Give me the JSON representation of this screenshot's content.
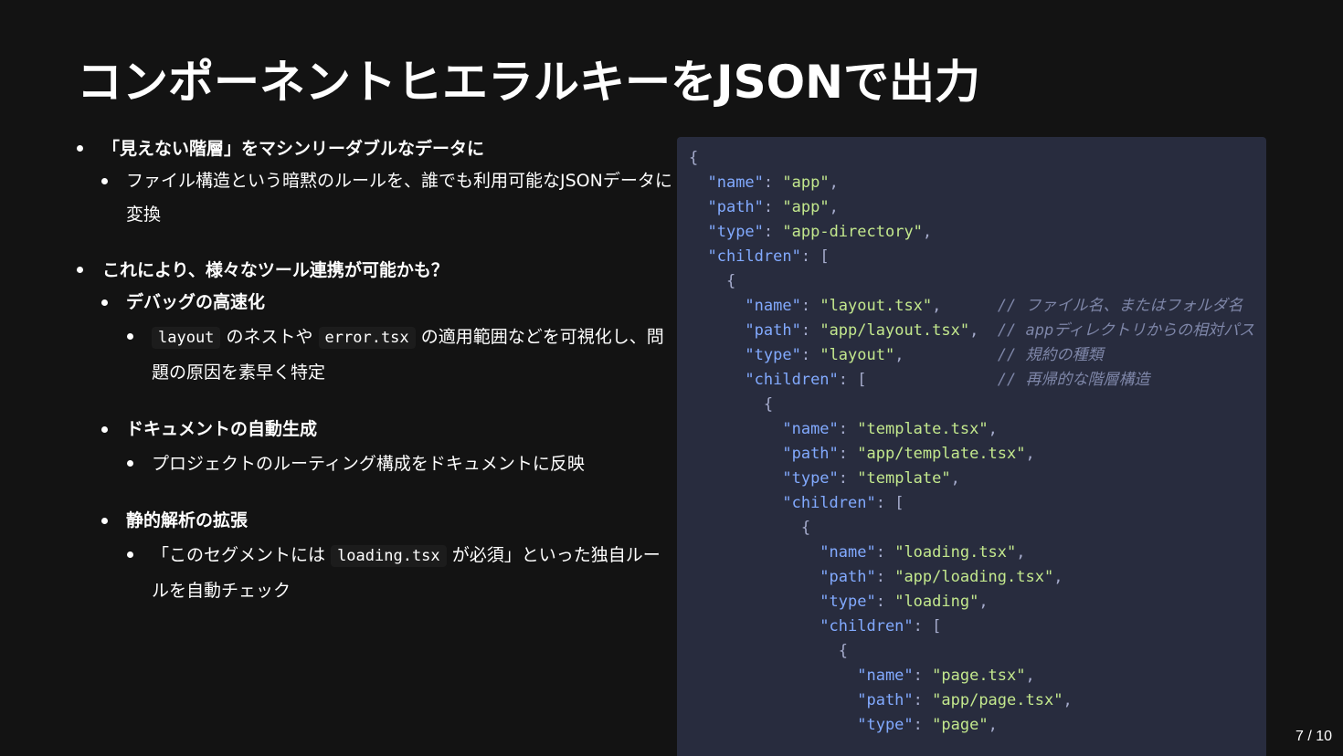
{
  "slide": {
    "title": "コンポーネントヒエラルキーをJSONで出力",
    "page_indicator": "7 / 10"
  },
  "bullets": {
    "b1": {
      "text": "「見えない階層」をマシンリーダブルなデータに",
      "sub1": "ファイル構造という暗黙のルールを、誰でも利用可能なJSONデータに変換"
    },
    "b2": {
      "text": "これにより、様々なツール連携が可能かも？",
      "debug": {
        "text": "デバッグの高速化",
        "detail_code1": "layout",
        "detail_mid": "のネストや",
        "detail_code2": "error.tsx",
        "detail_end": "の適用範囲などを可視化し、問題の原因を素早く特定"
      },
      "docs": {
        "text": "ドキュメントの自動生成",
        "detail": "プロジェクトのルーティング構成をドキュメントに反映"
      },
      "static": {
        "text": "静的解析の拡張",
        "detail_start": "「このセグメントには",
        "detail_code": "loading.tsx",
        "detail_end": "が必須」といった独自ルールを自動チェック"
      }
    }
  },
  "code": {
    "lang": "json",
    "lines": [
      {
        "indent": "",
        "parts": [
          {
            "t": "pun",
            "v": "{"
          }
        ]
      },
      {
        "indent": "  ",
        "parts": [
          {
            "t": "key",
            "v": "\"name\""
          },
          {
            "t": "pun",
            "v": ": "
          },
          {
            "t": "str",
            "v": "\"app\""
          },
          {
            "t": "pun",
            "v": ","
          }
        ]
      },
      {
        "indent": "  ",
        "parts": [
          {
            "t": "key",
            "v": "\"path\""
          },
          {
            "t": "pun",
            "v": ": "
          },
          {
            "t": "str",
            "v": "\"app\""
          },
          {
            "t": "pun",
            "v": ","
          }
        ]
      },
      {
        "indent": "  ",
        "parts": [
          {
            "t": "key",
            "v": "\"type\""
          },
          {
            "t": "pun",
            "v": ": "
          },
          {
            "t": "str",
            "v": "\"app-directory\""
          },
          {
            "t": "pun",
            "v": ","
          }
        ]
      },
      {
        "indent": "  ",
        "parts": [
          {
            "t": "key",
            "v": "\"children\""
          },
          {
            "t": "pun",
            "v": ": ["
          }
        ]
      },
      {
        "indent": "    ",
        "parts": [
          {
            "t": "pun",
            "v": "{"
          }
        ]
      },
      {
        "indent": "      ",
        "parts": [
          {
            "t": "key",
            "v": "\"name\""
          },
          {
            "t": "pun",
            "v": ": "
          },
          {
            "t": "str",
            "v": "\"layout.tsx\""
          },
          {
            "t": "pun",
            "v": ",      "
          },
          {
            "t": "cmt",
            "v": "// ファイル名、またはフォルダ名"
          }
        ]
      },
      {
        "indent": "      ",
        "parts": [
          {
            "t": "key",
            "v": "\"path\""
          },
          {
            "t": "pun",
            "v": ": "
          },
          {
            "t": "str",
            "v": "\"app/layout.tsx\""
          },
          {
            "t": "pun",
            "v": ",  "
          },
          {
            "t": "cmt",
            "v": "// appディレクトリからの相対パス"
          }
        ]
      },
      {
        "indent": "      ",
        "parts": [
          {
            "t": "key",
            "v": "\"type\""
          },
          {
            "t": "pun",
            "v": ": "
          },
          {
            "t": "str",
            "v": "\"layout\""
          },
          {
            "t": "pun",
            "v": ",          "
          },
          {
            "t": "cmt",
            "v": "// 規約の種類"
          }
        ]
      },
      {
        "indent": "      ",
        "parts": [
          {
            "t": "key",
            "v": "\"children\""
          },
          {
            "t": "pun",
            "v": ": [              "
          },
          {
            "t": "cmt",
            "v": "// 再帰的な階層構造"
          }
        ]
      },
      {
        "indent": "        ",
        "parts": [
          {
            "t": "pun",
            "v": "{"
          }
        ]
      },
      {
        "indent": "          ",
        "parts": [
          {
            "t": "key",
            "v": "\"name\""
          },
          {
            "t": "pun",
            "v": ": "
          },
          {
            "t": "str",
            "v": "\"template.tsx\""
          },
          {
            "t": "pun",
            "v": ","
          }
        ]
      },
      {
        "indent": "          ",
        "parts": [
          {
            "t": "key",
            "v": "\"path\""
          },
          {
            "t": "pun",
            "v": ": "
          },
          {
            "t": "str",
            "v": "\"app/template.tsx\""
          },
          {
            "t": "pun",
            "v": ","
          }
        ]
      },
      {
        "indent": "          ",
        "parts": [
          {
            "t": "key",
            "v": "\"type\""
          },
          {
            "t": "pun",
            "v": ": "
          },
          {
            "t": "str",
            "v": "\"template\""
          },
          {
            "t": "pun",
            "v": ","
          }
        ]
      },
      {
        "indent": "          ",
        "parts": [
          {
            "t": "key",
            "v": "\"children\""
          },
          {
            "t": "pun",
            "v": ": ["
          }
        ]
      },
      {
        "indent": "            ",
        "parts": [
          {
            "t": "pun",
            "v": "{"
          }
        ]
      },
      {
        "indent": "              ",
        "parts": [
          {
            "t": "key",
            "v": "\"name\""
          },
          {
            "t": "pun",
            "v": ": "
          },
          {
            "t": "str",
            "v": "\"loading.tsx\""
          },
          {
            "t": "pun",
            "v": ","
          }
        ]
      },
      {
        "indent": "              ",
        "parts": [
          {
            "t": "key",
            "v": "\"path\""
          },
          {
            "t": "pun",
            "v": ": "
          },
          {
            "t": "str",
            "v": "\"app/loading.tsx\""
          },
          {
            "t": "pun",
            "v": ","
          }
        ]
      },
      {
        "indent": "              ",
        "parts": [
          {
            "t": "key",
            "v": "\"type\""
          },
          {
            "t": "pun",
            "v": ": "
          },
          {
            "t": "str",
            "v": "\"loading\""
          },
          {
            "t": "pun",
            "v": ","
          }
        ]
      },
      {
        "indent": "              ",
        "parts": [
          {
            "t": "key",
            "v": "\"children\""
          },
          {
            "t": "pun",
            "v": ": ["
          }
        ]
      },
      {
        "indent": "                ",
        "parts": [
          {
            "t": "pun",
            "v": "{"
          }
        ]
      },
      {
        "indent": "                  ",
        "parts": [
          {
            "t": "key",
            "v": "\"name\""
          },
          {
            "t": "pun",
            "v": ": "
          },
          {
            "t": "str",
            "v": "\"page.tsx\""
          },
          {
            "t": "pun",
            "v": ","
          }
        ]
      },
      {
        "indent": "                  ",
        "parts": [
          {
            "t": "key",
            "v": "\"path\""
          },
          {
            "t": "pun",
            "v": ": "
          },
          {
            "t": "str",
            "v": "\"app/page.tsx\""
          },
          {
            "t": "pun",
            "v": ","
          }
        ]
      },
      {
        "indent": "                  ",
        "parts": [
          {
            "t": "key",
            "v": "\"type\""
          },
          {
            "t": "pun",
            "v": ": "
          },
          {
            "t": "str",
            "v": "\"page\""
          },
          {
            "t": "pun",
            "v": ","
          }
        ]
      }
    ]
  },
  "colors": {
    "background": "#131313",
    "code_background": "#282c3e",
    "code_key": "#82aaff",
    "code_string": "#c3e88d",
    "code_punctuation": "#a6accd",
    "code_comment": "#7e86a8",
    "text": "#ffffff"
  }
}
